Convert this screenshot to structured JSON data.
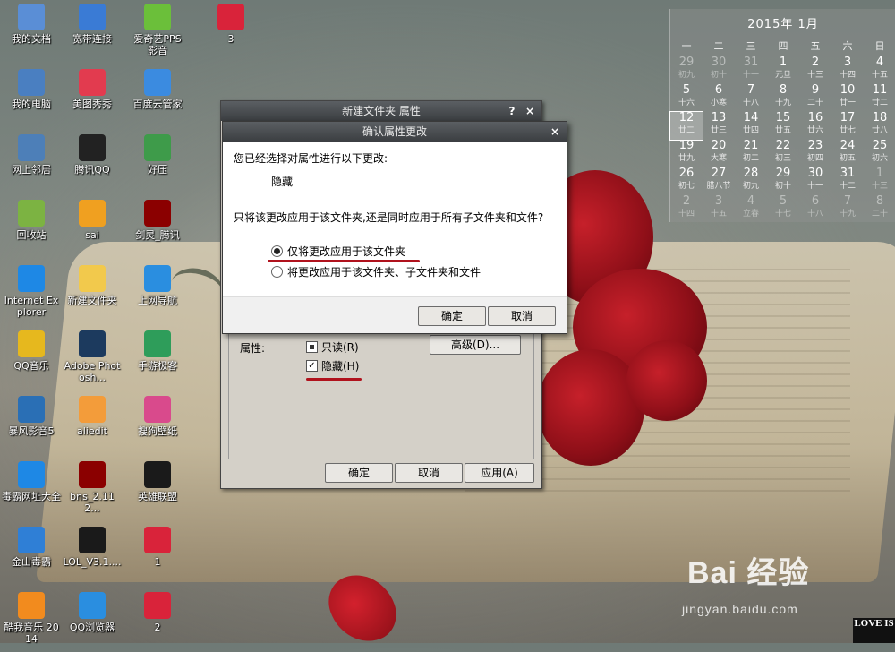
{
  "desktop_icons": [
    {
      "label": "我的文档",
      "icon": "folder-documents-icon",
      "color": "#5a8ed6"
    },
    {
      "label": "宽带连接",
      "icon": "network-connection-icon",
      "color": "#3a7bd5"
    },
    {
      "label": "爱奇艺PPS 影音",
      "icon": "iqiyi-app-icon",
      "color": "#6bbf3a"
    },
    {
      "label": "3",
      "icon": "meitu-image-icon",
      "color": "#d9233a"
    },
    {
      "label": "我的电脑",
      "icon": "computer-icon",
      "color": "#4a7fc1"
    },
    {
      "label": "美图秀秀",
      "icon": "meitu-app-icon",
      "color": "#e23b4f"
    },
    {
      "label": "百度云管家",
      "icon": "baidu-cloud-icon",
      "color": "#3b8be0"
    },
    {
      "label": "网上邻居",
      "icon": "network-neighborhood-icon",
      "color": "#4d7fb8"
    },
    {
      "label": "腾讯QQ",
      "icon": "qq-penguin-icon",
      "color": "#222222"
    },
    {
      "label": "好压",
      "icon": "haozip-icon",
      "color": "#3e9b4a"
    },
    {
      "label": "回收站",
      "icon": "recycle-bin-icon",
      "color": "#7cb342"
    },
    {
      "label": "sai",
      "icon": "sai-paint-icon",
      "color": "#f0a020"
    },
    {
      "label": "剑灵_腾讯",
      "icon": "blade-soul-icon",
      "color": "#8b0000"
    },
    {
      "label": "Internet Explorer",
      "icon": "internet-explorer-icon",
      "color": "#1e88e5"
    },
    {
      "label": "新建文件夹",
      "icon": "folder-icon",
      "color": "#f2c94c"
    },
    {
      "label": "上网导航",
      "icon": "ie-navigation-icon",
      "color": "#2a8ee0"
    },
    {
      "label": "QQ音乐",
      "icon": "qq-music-icon",
      "color": "#e6b81e"
    },
    {
      "label": "Adobe Photosh...",
      "icon": "photoshop-icon",
      "color": "#1c3a5e"
    },
    {
      "label": "手游极客",
      "icon": "mobile-game-icon",
      "color": "#2e9d5a"
    },
    {
      "label": "暴风影音5",
      "icon": "baofeng-player-icon",
      "color": "#2a6fb5"
    },
    {
      "label": "aliedit",
      "icon": "alipay-edit-icon",
      "color": "#f39c3a"
    },
    {
      "label": "搜狗壁纸",
      "icon": "sogou-wallpaper-icon",
      "color": "#d94a8c"
    },
    {
      "label": "毒霸网址大全",
      "icon": "duba-browser-icon",
      "color": "#1e88e5"
    },
    {
      "label": "bns_2.112...",
      "icon": "blade-soul-icon",
      "color": "#8b0000"
    },
    {
      "label": "英雄联盟",
      "icon": "lol-icon",
      "color": "#1a1a1a"
    },
    {
      "label": "金山毒霸",
      "icon": "kingsoft-antivirus-icon",
      "color": "#2f7fd6"
    },
    {
      "label": "LOL_V3.1....",
      "icon": "lol-installer-icon",
      "color": "#1a1a1a"
    },
    {
      "label": "1",
      "icon": "meitu-image-icon",
      "color": "#d9233a"
    },
    {
      "label": "酷我音乐 2014",
      "icon": "kuwo-music-icon",
      "color": "#f28b1e"
    },
    {
      "label": "QQ浏览器",
      "icon": "qq-browser-icon",
      "color": "#2a8ee0"
    },
    {
      "label": "2",
      "icon": "meitu-image-icon",
      "color": "#d9233a"
    }
  ],
  "calendar": {
    "title": "2015年  1月",
    "weekdays": [
      "一",
      "二",
      "三",
      "四",
      "五",
      "六",
      "日"
    ],
    "weeks": [
      [
        {
          "d": "29",
          "s": "初九",
          "dim": true
        },
        {
          "d": "30",
          "s": "初十",
          "dim": true
        },
        {
          "d": "31",
          "s": "十一",
          "dim": true
        },
        {
          "d": "1",
          "s": "元旦"
        },
        {
          "d": "2",
          "s": "十三"
        },
        {
          "d": "3",
          "s": "十四"
        },
        {
          "d": "4",
          "s": "十五"
        }
      ],
      [
        {
          "d": "5",
          "s": "十六"
        },
        {
          "d": "6",
          "s": "小寒"
        },
        {
          "d": "7",
          "s": "十八"
        },
        {
          "d": "8",
          "s": "十九"
        },
        {
          "d": "9",
          "s": "二十"
        },
        {
          "d": "10",
          "s": "廿一"
        },
        {
          "d": "11",
          "s": "廿二"
        }
      ],
      [
        {
          "d": "12",
          "s": "廿二",
          "today": true
        },
        {
          "d": "13",
          "s": "廿三"
        },
        {
          "d": "14",
          "s": "廿四"
        },
        {
          "d": "15",
          "s": "廿五"
        },
        {
          "d": "16",
          "s": "廿六"
        },
        {
          "d": "17",
          "s": "廿七"
        },
        {
          "d": "18",
          "s": "廿八"
        }
      ],
      [
        {
          "d": "19",
          "s": "廿九"
        },
        {
          "d": "20",
          "s": "大寒"
        },
        {
          "d": "21",
          "s": "初二"
        },
        {
          "d": "22",
          "s": "初三"
        },
        {
          "d": "23",
          "s": "初四"
        },
        {
          "d": "24",
          "s": "初五"
        },
        {
          "d": "25",
          "s": "初六"
        }
      ],
      [
        {
          "d": "26",
          "s": "初七"
        },
        {
          "d": "27",
          "s": "腊八节"
        },
        {
          "d": "28",
          "s": "初九"
        },
        {
          "d": "29",
          "s": "初十"
        },
        {
          "d": "30",
          "s": "十一"
        },
        {
          "d": "31",
          "s": "十二"
        },
        {
          "d": "1",
          "s": "十三",
          "dim": true
        }
      ],
      [
        {
          "d": "2",
          "s": "十四",
          "dim": true
        },
        {
          "d": "3",
          "s": "十五",
          "dim": true
        },
        {
          "d": "4",
          "s": "立春",
          "dim": true
        },
        {
          "d": "5",
          "s": "十七",
          "dim": true
        },
        {
          "d": "6",
          "s": "十八",
          "dim": true
        },
        {
          "d": "7",
          "s": "十九",
          "dim": true
        },
        {
          "d": "8",
          "s": "二十",
          "dim": true
        }
      ]
    ]
  },
  "properties_window": {
    "title": "新建文件夹 属性",
    "help_btn": "?",
    "close_btn": "×",
    "attributes_label": "属性:",
    "readonly_label": "只读(R)",
    "hidden_label": "隐藏(H)",
    "hidden_checked": true,
    "advanced_btn": "高级(D)...",
    "ok_btn": "确定",
    "cancel_btn": "取消",
    "apply_btn": "应用(A)"
  },
  "confirm_dialog": {
    "title": "确认属性更改",
    "close_btn": "×",
    "intro": "您已经选择对属性进行以下更改:",
    "change": "隐藏",
    "question": "只将该更改应用于该文件夹,还是同时应用于所有子文件夹和文件?",
    "option_folder_only": "仅将更改应用于该文件夹",
    "option_all": "将更改应用于该文件夹、子文件夹和文件",
    "selected": "option_folder_only",
    "ok_btn": "确定",
    "cancel_btn": "取消"
  },
  "watermark": {
    "brand": "Bai  经验",
    "url": "jingyan.baidu.com"
  },
  "badge": {
    "text": "LOVE IS"
  },
  "colors": {
    "annotation_red": "#b0121d",
    "titlebar": "#3b3e41"
  }
}
